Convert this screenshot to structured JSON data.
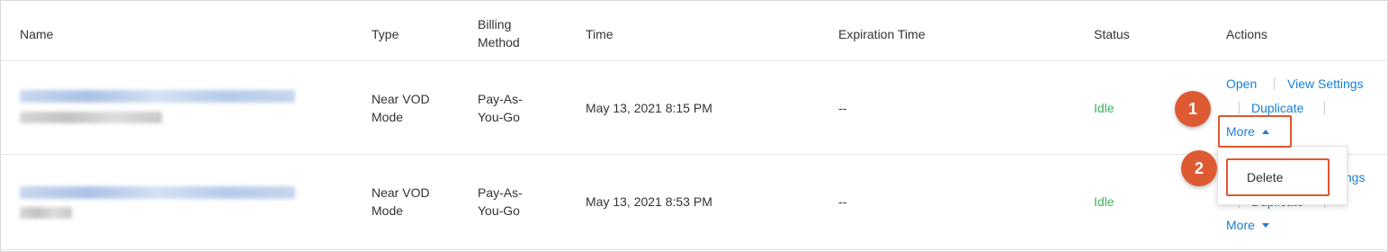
{
  "table": {
    "headers": {
      "name": "Name",
      "type": "Type",
      "billing": "Billing\nMethod",
      "time": "Time",
      "expiration": "Expiration Time",
      "status": "Status",
      "actions": "Actions"
    },
    "rows": [
      {
        "type_line1": "Near VOD",
        "type_line2": "Mode",
        "billing_line1": "Pay-As-",
        "billing_line2": "You-Go",
        "time": "May 13, 2021 8:15 PM",
        "expiration": "--",
        "status": "Idle",
        "actions": {
          "open": "Open",
          "view_settings": "View Settings",
          "duplicate": "Duplicate",
          "more": "More"
        }
      },
      {
        "type_line1": "Near VOD",
        "type_line2": "Mode",
        "billing_line1": "Pay-As-",
        "billing_line2": "You-Go",
        "time": "May 13, 2021 8:53 PM",
        "expiration": "--",
        "status": "Idle",
        "actions": {
          "view_settings_partial": "ttings",
          "duplicate": "Duplicate",
          "more": "More"
        }
      }
    ]
  },
  "dropdown": {
    "items": [
      "Delete"
    ]
  },
  "callouts": {
    "step1": "1",
    "step2": "2",
    "color": "#de5a32"
  },
  "colors": {
    "link": "#1b7ed3",
    "status_idle": "#3fb35b",
    "border": "#e5e5e5"
  }
}
